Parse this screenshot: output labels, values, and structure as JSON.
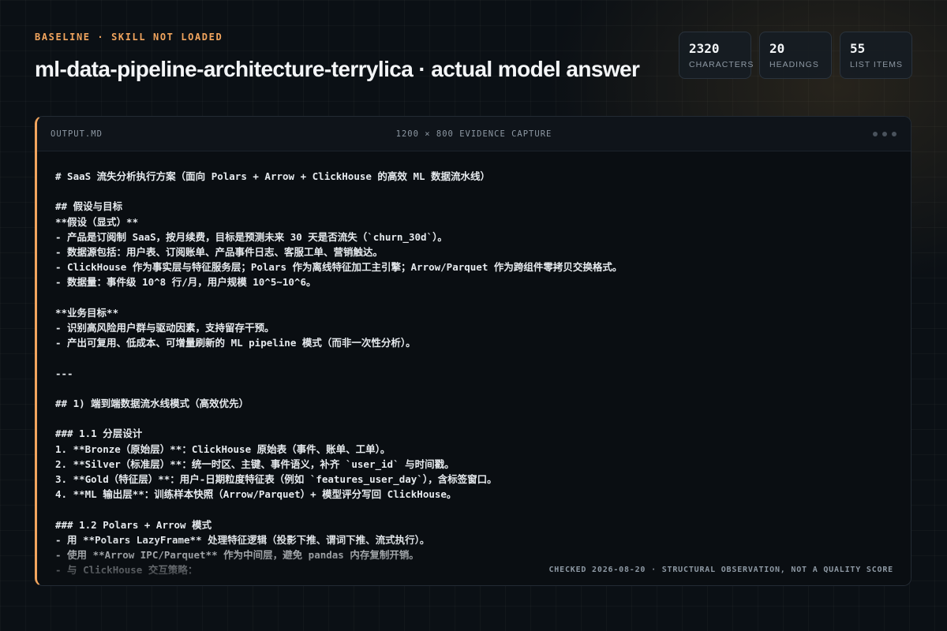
{
  "header": {
    "eyebrow": "BASELINE · SKILL NOT LOADED",
    "title": "ml-data-pipeline-architecture-terrylica · actual model answer"
  },
  "stats": [
    {
      "value": "2320",
      "label": "CHARACTERS"
    },
    {
      "value": "20",
      "label": "HEADINGS"
    },
    {
      "value": "55",
      "label": "LIST ITEMS"
    }
  ],
  "panel": {
    "filename": "OUTPUT.MD",
    "capture_label": "1200 × 800 EVIDENCE CAPTURE",
    "footer_note": "CHECKED 2026-08-20 · STRUCTURAL OBSERVATION, NOT A QUALITY SCORE",
    "lines": [
      "# SaaS 流失分析执行方案（面向 Polars + Arrow + ClickHouse 的高效 ML 数据流水线）",
      "",
      "## 假设与目标",
      "**假设（显式）**",
      "- 产品是订阅制 SaaS，按月续费，目标是预测未来 30 天是否流失（`churn_30d`）。",
      "- 数据源包括：用户表、订阅账单、产品事件日志、客服工单、营销触达。",
      "- ClickHouse 作为事实层与特征服务层；Polars 作为离线特征加工主引擎；Arrow/Parquet 作为跨组件零拷贝交换格式。",
      "- 数据量：事件级 10^8 行/月，用户规模 10^5~10^6。",
      "",
      "**业务目标**",
      "- 识别高风险用户群与驱动因素，支持留存干预。",
      "- 产出可复用、低成本、可增量刷新的 ML pipeline 模式（而非一次性分析）。",
      "",
      "---",
      "",
      "## 1) 端到端数据流水线模式（高效优先）",
      "",
      "### 1.1 分层设计",
      "1. **Bronze（原始层）**：ClickHouse 原始表（事件、账单、工单）。",
      "2. **Silver（标准层）**：统一时区、主键、事件语义，补齐 `user_id` 与时间戳。",
      "3. **Gold（特征层）**：用户-日期粒度特征表（例如 `features_user_day`），含标签窗口。",
      "4. **ML 输出层**：训练样本快照（Arrow/Parquet）+ 模型评分写回 ClickHouse。",
      "",
      "### 1.2 Polars + Arrow 模式",
      "- 用 **Polars LazyFrame** 处理特征逻辑（投影下推、谓词下推、流式执行）。",
      "- 使用 **Arrow IPC/Parquet** 作为中间层，避免 pandas 内存复制开销。",
      "- 与 ClickHouse 交互策略："
    ]
  }
}
